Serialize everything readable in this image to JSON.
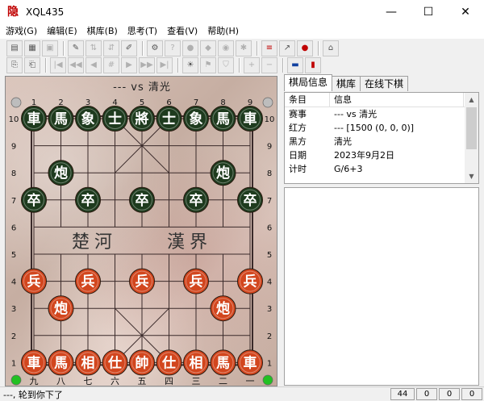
{
  "window": {
    "title": "XQL435",
    "icon_char": "隐"
  },
  "menu": [
    "游戏(G)",
    "编辑(E)",
    "棋库(B)",
    "思考(T)",
    "查看(V)",
    "帮助(H)"
  ],
  "board": {
    "header": "--- vs 清光",
    "files_top": [
      "1",
      "2",
      "3",
      "4",
      "5",
      "6",
      "7",
      "8",
      "9"
    ],
    "files_bottom": [
      "九",
      "八",
      "七",
      "六",
      "五",
      "四",
      "三",
      "二",
      "一"
    ],
    "ranks": [
      "10",
      "9",
      "8",
      "7",
      "6",
      "5",
      "4",
      "3",
      "2",
      "1"
    ],
    "river_left": "楚河",
    "river_right": "漢界",
    "pieces": [
      {
        "side": "black",
        "char": "車",
        "file": 0,
        "rank": 0
      },
      {
        "side": "black",
        "char": "馬",
        "file": 1,
        "rank": 0
      },
      {
        "side": "black",
        "char": "象",
        "file": 2,
        "rank": 0
      },
      {
        "side": "black",
        "char": "士",
        "file": 3,
        "rank": 0
      },
      {
        "side": "black",
        "char": "將",
        "file": 4,
        "rank": 0
      },
      {
        "side": "black",
        "char": "士",
        "file": 5,
        "rank": 0
      },
      {
        "side": "black",
        "char": "象",
        "file": 6,
        "rank": 0
      },
      {
        "side": "black",
        "char": "馬",
        "file": 7,
        "rank": 0
      },
      {
        "side": "black",
        "char": "車",
        "file": 8,
        "rank": 0
      },
      {
        "side": "black",
        "char": "炮",
        "file": 1,
        "rank": 2
      },
      {
        "side": "black",
        "char": "炮",
        "file": 7,
        "rank": 2
      },
      {
        "side": "black",
        "char": "卒",
        "file": 0,
        "rank": 3
      },
      {
        "side": "black",
        "char": "卒",
        "file": 2,
        "rank": 3
      },
      {
        "side": "black",
        "char": "卒",
        "file": 4,
        "rank": 3
      },
      {
        "side": "black",
        "char": "卒",
        "file": 6,
        "rank": 3
      },
      {
        "side": "black",
        "char": "卒",
        "file": 8,
        "rank": 3
      },
      {
        "side": "red",
        "char": "兵",
        "file": 0,
        "rank": 6
      },
      {
        "side": "red",
        "char": "兵",
        "file": 2,
        "rank": 6
      },
      {
        "side": "red",
        "char": "兵",
        "file": 4,
        "rank": 6
      },
      {
        "side": "red",
        "char": "兵",
        "file": 6,
        "rank": 6
      },
      {
        "side": "red",
        "char": "兵",
        "file": 8,
        "rank": 6
      },
      {
        "side": "red",
        "char": "炮",
        "file": 1,
        "rank": 7
      },
      {
        "side": "red",
        "char": "炮",
        "file": 7,
        "rank": 7
      },
      {
        "side": "red",
        "char": "車",
        "file": 0,
        "rank": 9
      },
      {
        "side": "red",
        "char": "馬",
        "file": 1,
        "rank": 9
      },
      {
        "side": "red",
        "char": "相",
        "file": 2,
        "rank": 9
      },
      {
        "side": "red",
        "char": "仕",
        "file": 3,
        "rank": 9
      },
      {
        "side": "red",
        "char": "帥",
        "file": 4,
        "rank": 9
      },
      {
        "side": "red",
        "char": "仕",
        "file": 5,
        "rank": 9
      },
      {
        "side": "red",
        "char": "相",
        "file": 6,
        "rank": 9
      },
      {
        "side": "red",
        "char": "馬",
        "file": 7,
        "rank": 9
      },
      {
        "side": "red",
        "char": "車",
        "file": 8,
        "rank": 9
      }
    ],
    "colors": {
      "black_piece": "#1e3b1e",
      "red_piece": "#d2461e",
      "piece_text": "#ffffff",
      "line": "#3a2a2a"
    }
  },
  "tabs": [
    "棋局信息",
    "棋库",
    "在线下棋"
  ],
  "info": {
    "headers": [
      "条目",
      "信息"
    ],
    "rows": [
      {
        "key": "赛事",
        "value": "--- vs 清光"
      },
      {
        "key": "红方",
        "value": "--- [1500 (0, 0, 0)]"
      },
      {
        "key": "黑方",
        "value": "清光"
      },
      {
        "key": "日期",
        "value": "2023年9月2日"
      },
      {
        "key": "计时",
        "value": "G/6+3"
      }
    ]
  },
  "status": {
    "text": "---, 轮到你下了",
    "cells": [
      "44",
      "0",
      "0",
      "0"
    ]
  }
}
